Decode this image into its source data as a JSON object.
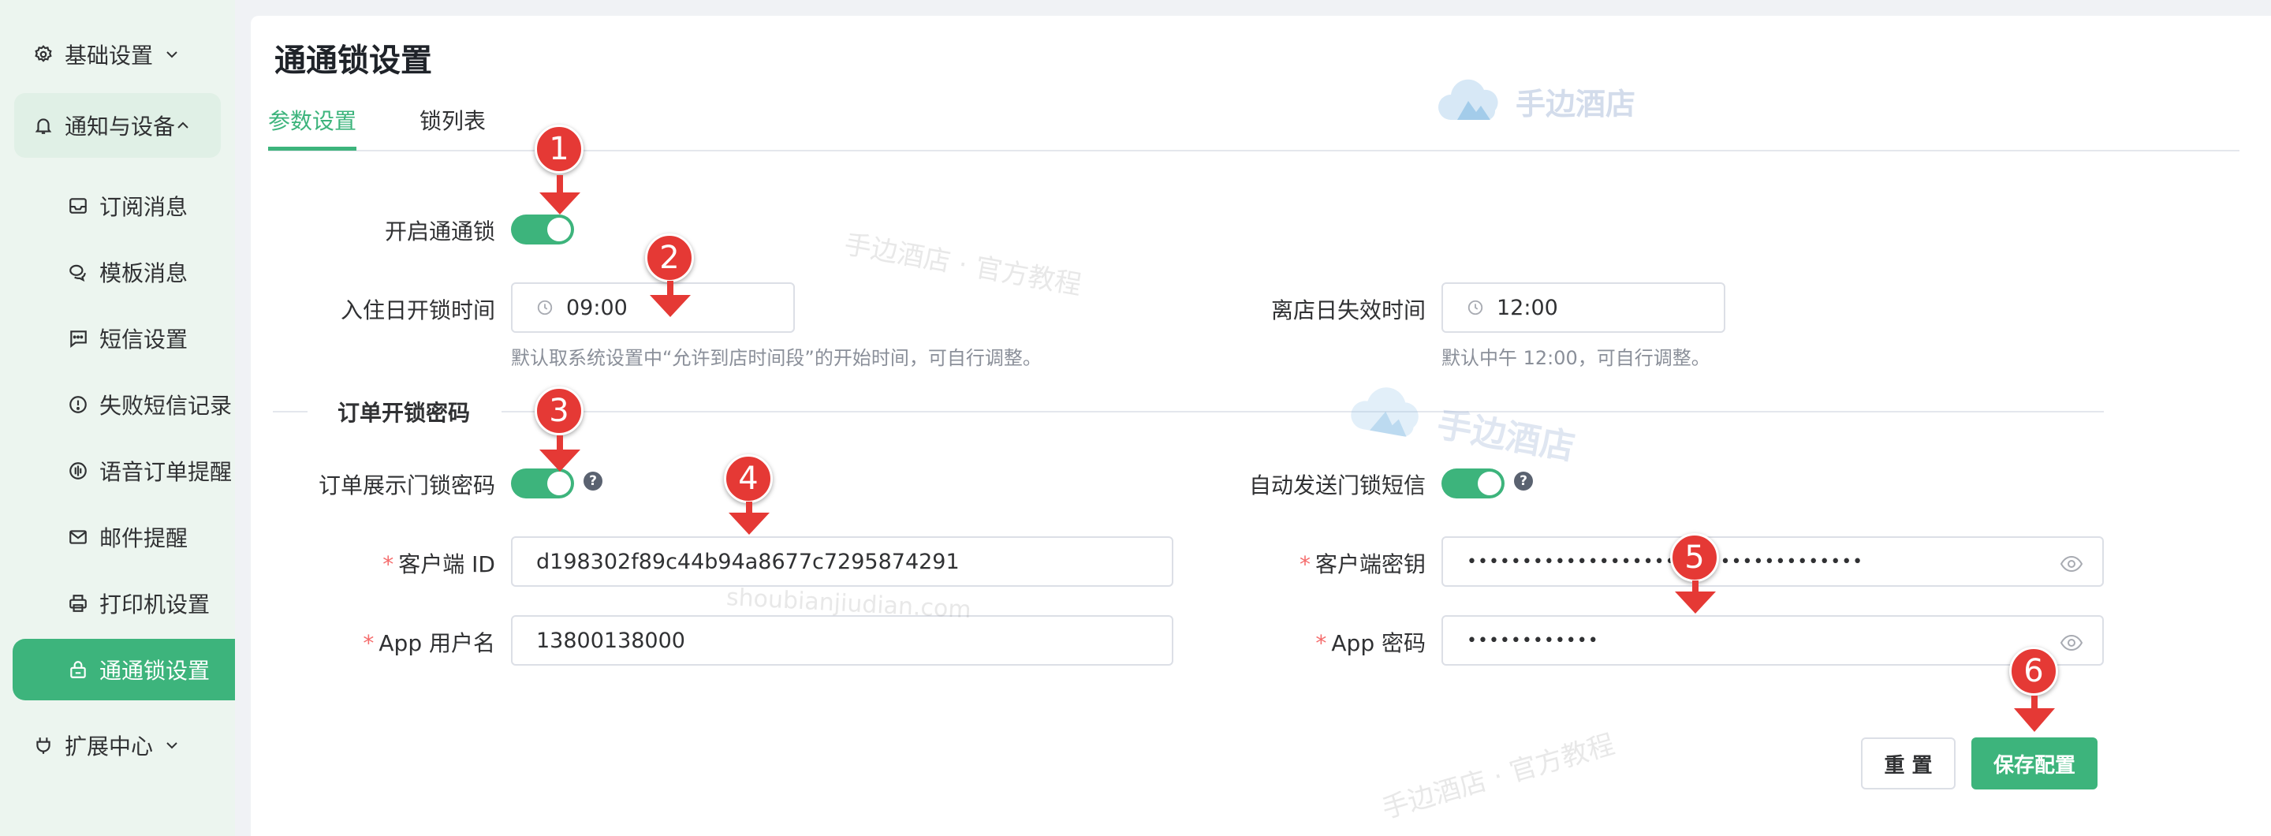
{
  "sidebar": {
    "groups": [
      {
        "label": "基础设置",
        "icon": "gear-icon"
      },
      {
        "label": "通知与设备",
        "icon": "bell-icon"
      },
      {
        "label": "扩展中心",
        "icon": "plug-icon"
      }
    ],
    "items": [
      {
        "label": "订阅消息",
        "icon": "inbox-icon"
      },
      {
        "label": "模板消息",
        "icon": "chat-icon"
      },
      {
        "label": "短信设置",
        "icon": "message-icon"
      },
      {
        "label": "失败短信记录",
        "icon": "alert-circle-icon"
      },
      {
        "label": "语音订单提醒",
        "icon": "voice-icon"
      },
      {
        "label": "邮件提醒",
        "icon": "mail-icon"
      },
      {
        "label": "打印机设置",
        "icon": "printer-icon"
      },
      {
        "label": "通通锁设置",
        "icon": "lock-icon"
      }
    ]
  },
  "page": {
    "title": "通通锁设置",
    "tabs": [
      {
        "label": "参数设置"
      },
      {
        "label": "锁列表"
      }
    ]
  },
  "form": {
    "enable_lock_label": "开启通通锁",
    "checkin_unlock_label": "入住日开锁时间",
    "checkin_unlock_value": "09:00",
    "checkin_hint": "默认取系统设置中“允许到店时间段”的开始时间，可自行调整。",
    "checkout_expire_label": "离店日失效时间",
    "checkout_expire_value": "12:00",
    "checkout_hint": "默认中午 12:00，可自行调整。",
    "section_title": "订单开锁密码",
    "show_password_label": "订单展示门锁密码",
    "auto_sms_label": "自动发送门锁短信",
    "help_glyph": "?",
    "required_mark": "*",
    "client_id_label": "客户端 ID",
    "client_id_value": "d198302f89c44b94a8677c7295874291",
    "client_secret_label": "客户端密钥",
    "client_secret_value": "••••••••••••••••••••••••••••••••••••",
    "app_user_label": "App 用户名",
    "app_user_value": "13800138000",
    "app_password_label": "App 密码",
    "app_password_value": "••••••••••••",
    "reset_label": "重 置",
    "save_label": "保存配置"
  },
  "watermarks": {
    "logo_text": "手边酒店",
    "tutorial": "手边酒店 · 官方教程",
    "domain": "shoubianjiudian.com"
  },
  "markers": [
    "1",
    "2",
    "3",
    "4",
    "5",
    "6"
  ],
  "colors": {
    "accent": "#3db47c",
    "marker": "#e53935",
    "required": "#f56c6c"
  }
}
